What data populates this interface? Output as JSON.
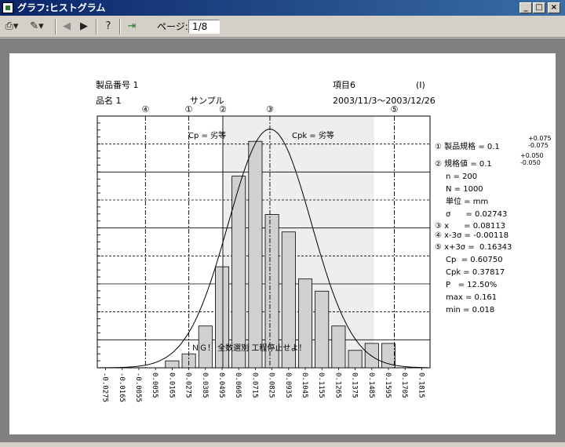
{
  "window": {
    "title": "グラフ:ヒストグラム"
  },
  "toolbar": {
    "page_label": "ページ:",
    "page_value": "1/8"
  },
  "header": {
    "product_no": "製品番号 1",
    "item": "項目6",
    "i_mark": "(I)",
    "product_name": "品名 1",
    "sample": "サンプル",
    "date_range": "2003/11/3～2003/12/26"
  },
  "chart_data": {
    "type": "bar",
    "x_ticks": [
      "-0.0275",
      "-0.0165",
      "-0.0055",
      "0.0055",
      "0.0165",
      "0.0275",
      "0.0385",
      "0.0495",
      "0.0605",
      "0.0715",
      "0.0825",
      "0.0935",
      "0.1045",
      "0.1155",
      "0.1265",
      "0.1375",
      "0.1485",
      "0.1595",
      "0.1705",
      "0.1815"
    ],
    "values": [
      0,
      0,
      0,
      0,
      0.2,
      0.4,
      1.2,
      2.9,
      5.5,
      6.5,
      4.4,
      3.9,
      2.55,
      2.2,
      1.2,
      0.5,
      0.7,
      0.7,
      0,
      0
    ],
    "ylim": [
      0,
      7
    ],
    "normal_curve": {
      "mean": 0.08113,
      "sigma": 0.02743
    },
    "markers": [
      {
        "label": "①",
        "x": 0.0275
      },
      {
        "label": "②",
        "x": 0.05
      },
      {
        "label": "③",
        "x": 0.08113
      },
      {
        "label": "④",
        "x": -0.00118
      },
      {
        "label": "⑤",
        "x": 0.16343
      }
    ],
    "spec_band": [
      0.05,
      0.15
    ],
    "cp_text": "Cp = 劣等",
    "cpk_text": "Cpk = 劣等",
    "ng_text": "ＮＧ！  全数選別  工程停止せよ！"
  },
  "stats": {
    "spec1_prefix": "① 製品規格 = 0.1",
    "spec1_plus": "+0.075",
    "spec1_minus": "-0.075",
    "spec2_prefix": "② 規格値 = 0.1",
    "spec2_plus": "+0.050",
    "spec2_minus": "-0.050",
    "n": "n = 200",
    "N": "N = 1000",
    "unit": "単位 = mm",
    "sigma": "σ      = 0.02743",
    "xbar": "③ x      = 0.08113",
    "xbar_minus": "④ x-3σ = -0.00118",
    "xbar_plus": "⑤ x+3σ =  0.16343",
    "cp": "Cp  = 0.60750",
    "cpk": "Cpk = 0.37817",
    "p": "P   = 12.50%",
    "max": "max = 0.161",
    "min": "min = 0.018"
  }
}
